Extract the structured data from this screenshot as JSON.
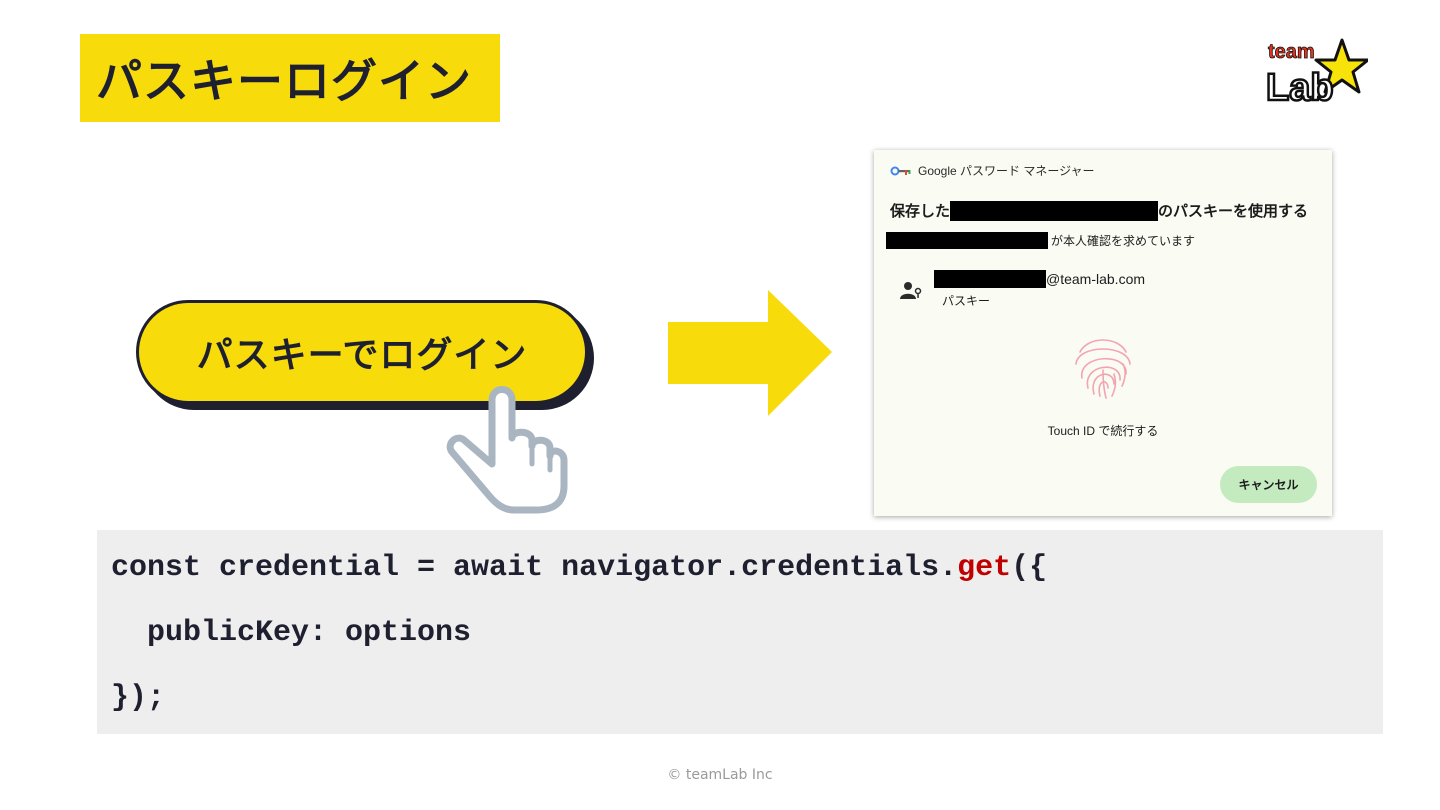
{
  "slide": {
    "title": "パスキーログイン",
    "footer": "© teamLab Inc"
  },
  "logo": {
    "line1": "team",
    "line2": "Lab"
  },
  "passkey_button": {
    "label": "パスキーでログイン"
  },
  "dialog": {
    "header": "Google パスワード マネージャー",
    "title_prefix": "保存した",
    "title_suffix": "のパスキーを使用する",
    "subtitle_suffix": "が本人確認を求めています",
    "account_email_suffix": "@team-lab.com",
    "account_type": "パスキー",
    "touch_id_label": "Touch ID で続行する",
    "cancel_label": "キャンセル"
  },
  "code": {
    "line1_before": "const credential = await navigator.credentials.",
    "line1_method": "get",
    "line1_after": "({",
    "line2": "  publicKey: options",
    "line3": "});"
  },
  "colors": {
    "accent_yellow": "#f7db0a",
    "dark": "#1e2030",
    "cancel_green": "#c4ebbf",
    "code_bg": "#eeeeee",
    "code_highlight": "#c00000"
  }
}
